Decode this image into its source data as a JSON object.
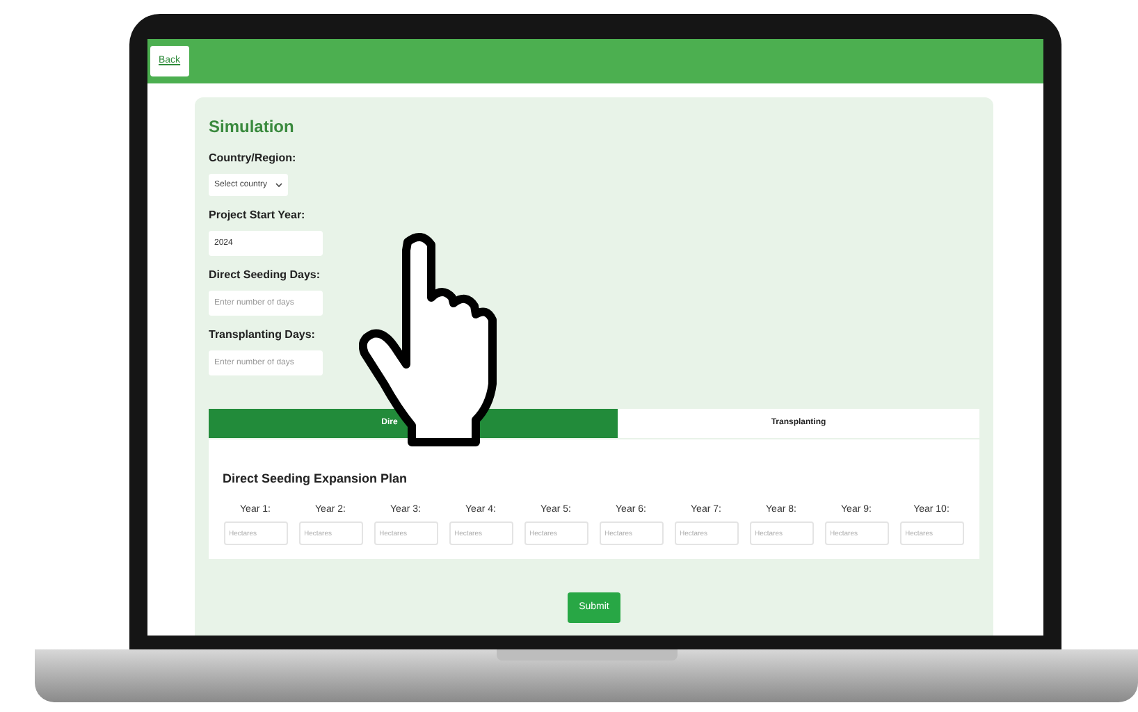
{
  "header": {
    "back_button": "Back"
  },
  "form": {
    "title": "Simulation",
    "fields": [
      {
        "kind": "select",
        "label": "Country/Region:",
        "value": "Select country"
      },
      {
        "kind": "input",
        "label": "Project Start Year:",
        "value": "2024"
      },
      {
        "kind": "input",
        "label": "Direct Seeding Days:",
        "placeholder": "Enter number of days"
      },
      {
        "kind": "input",
        "label": "Transplanting Days:",
        "placeholder": "Enter number of days"
      }
    ]
  },
  "tabs": [
    {
      "label": "Dire",
      "selected": true
    },
    {
      "label": "Transplanting",
      "selected": false
    }
  ],
  "plan": {
    "title": "Direct Seeding Expansion Plan",
    "years": [
      {
        "label": "Year 1:",
        "placeholder": "Hectares"
      },
      {
        "label": "Year 2:",
        "placeholder": "Hectares"
      },
      {
        "label": "Year 3:",
        "placeholder": "Hectares"
      },
      {
        "label": "Year 4:",
        "placeholder": "Hectares"
      },
      {
        "label": "Year 5:",
        "placeholder": "Hectares"
      },
      {
        "label": "Year 6:",
        "placeholder": "Hectares"
      },
      {
        "label": "Year 7:",
        "placeholder": "Hectares"
      },
      {
        "label": "Year 8:",
        "placeholder": "Hectares"
      },
      {
        "label": "Year 9:",
        "placeholder": "Hectares"
      },
      {
        "label": "Year 10:",
        "placeholder": "Hectares"
      }
    ]
  },
  "submit_button": "Submit"
}
